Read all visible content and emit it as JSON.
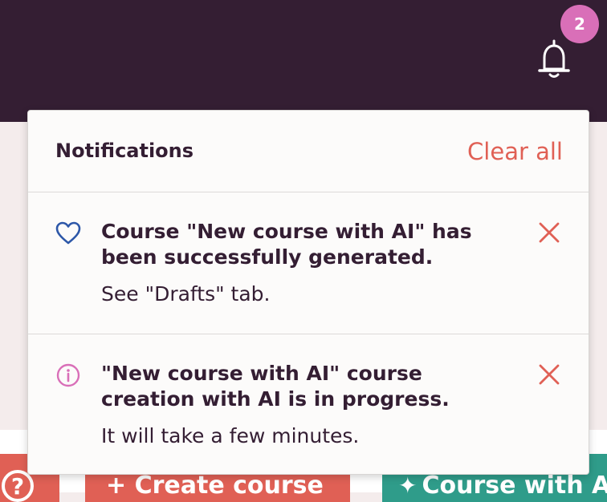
{
  "header": {
    "notification_count": "2",
    "bell_icon": "bell-icon"
  },
  "notifications_panel": {
    "title": "Notifications",
    "clear_all_label": "Clear all",
    "items": [
      {
        "icon": "heart-icon",
        "title": "Course \"New course with AI\" has been successfully generated.",
        "body": "See \"Drafts\" tab.",
        "close_icon": "close-icon"
      },
      {
        "icon": "info-icon",
        "title": "\"New course with AI\" course creation with AI is in progress.",
        "body": "It will take a few minutes.",
        "close_icon": "close-icon"
      }
    ]
  },
  "bottom_buttons": {
    "help_label": "?",
    "create_course_label": "+ Create course",
    "ai_course_label": "Course with AI",
    "ai_icon": "sparkle-icon"
  },
  "colors": {
    "topbar": "#341e33",
    "badge": "#d96fb8",
    "accent_red": "#e06055",
    "heart_blue": "#2d57a8",
    "info_pink": "#d96fb8",
    "teal": "#2f9c8a"
  }
}
